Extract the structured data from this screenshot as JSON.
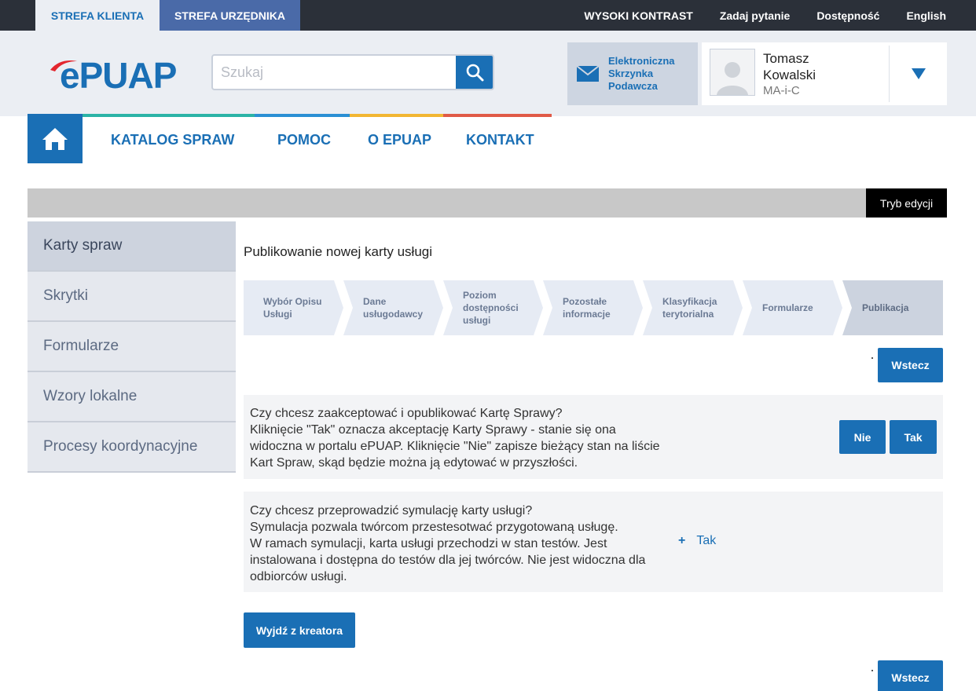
{
  "topbar": {
    "zones": [
      "STREFA KLIENTA",
      "STREFA URZĘDNIKA"
    ],
    "links": [
      "WYSOKI KONTRAST",
      "Zadaj pytanie",
      "Dostępność",
      "English"
    ]
  },
  "header": {
    "logo_text": "ePUAP",
    "search_placeholder": "Szukaj",
    "search_value": "",
    "inbox_lines": [
      "Elektroniczna",
      "Skrzynka",
      "Podawcza"
    ],
    "user_first": "Tomasz",
    "user_last": "Kowalski",
    "user_role": "MA-i-C"
  },
  "nav": {
    "items": [
      "KATALOG SPRAW",
      "POMOC",
      "O ePUAP",
      "KONTAKT"
    ],
    "stripe_colors": [
      "#2bb3a6",
      "#2a8fd4",
      "#f2b632",
      "#e05a47"
    ]
  },
  "edit_mode_label": "Tryb edycji",
  "sidebar": {
    "items": [
      "Karty spraw",
      "Skrytki",
      "Formularze",
      "Wzory lokalne",
      "Procesy koordynacyjne"
    ],
    "active_index": 0
  },
  "content": {
    "heading": "Publikowanie nowej karty usługi",
    "steps": [
      {
        "label": "Wybór Opisu Usługi",
        "lines": [
          "Wybór Opisu",
          "Usługi"
        ]
      },
      {
        "label": "Dane usługodawcy",
        "lines": [
          "Dane",
          "usługodawcy"
        ]
      },
      {
        "label": "Poziom dostępności usługi",
        "lines": [
          "Poziom",
          "dostępności",
          "usługi"
        ]
      },
      {
        "label": "Pozostałe informacje",
        "lines": [
          "Pozostałe",
          "informacje"
        ]
      },
      {
        "label": "Klasyfikacja terytorialna",
        "lines": [
          "Klasyfikacja",
          "terytorialna"
        ]
      },
      {
        "label": "Formularze",
        "lines": [
          "Formularze"
        ]
      },
      {
        "label": "Publikacja",
        "lines": [
          "Publikacja"
        ]
      }
    ],
    "active_step": 6,
    "back_label": "Wstecz",
    "publish_panel": {
      "lines": [
        "Czy chcesz zaakceptować i opublikować Kartę Sprawy?",
        "Kliknięcie \"Tak\" oznacza akceptację Karty Sprawy - stanie się ona",
        "widoczna w portalu ePUAP. Kliknięcie \"Nie\" zapisze bieżący stan na liście",
        "Kart Spraw, skąd będzie można ją edytować w przyszłości."
      ],
      "no_label": "Nie",
      "yes_label": "Tak"
    },
    "simulation_panel": {
      "lines": [
        "Czy chcesz przeprowadzić symulację karty usługi?",
        "Symulacja pozwala twórcom przestesotwać przygotowaną usługę.",
        "W ramach symulacji, karta usługi przechodzi w stan testów. Jest",
        "instalowana i dostępna do testów dla jej twórców. Nie jest widoczna dla",
        "odbiorców usługi."
      ],
      "yes_label": "Tak"
    },
    "exit_label": "Wyjdź z kreatora"
  },
  "colors": {
    "primary": "#1a6fb5",
    "topbar": "#2b3039",
    "official_zone": "#4a6aa8"
  }
}
